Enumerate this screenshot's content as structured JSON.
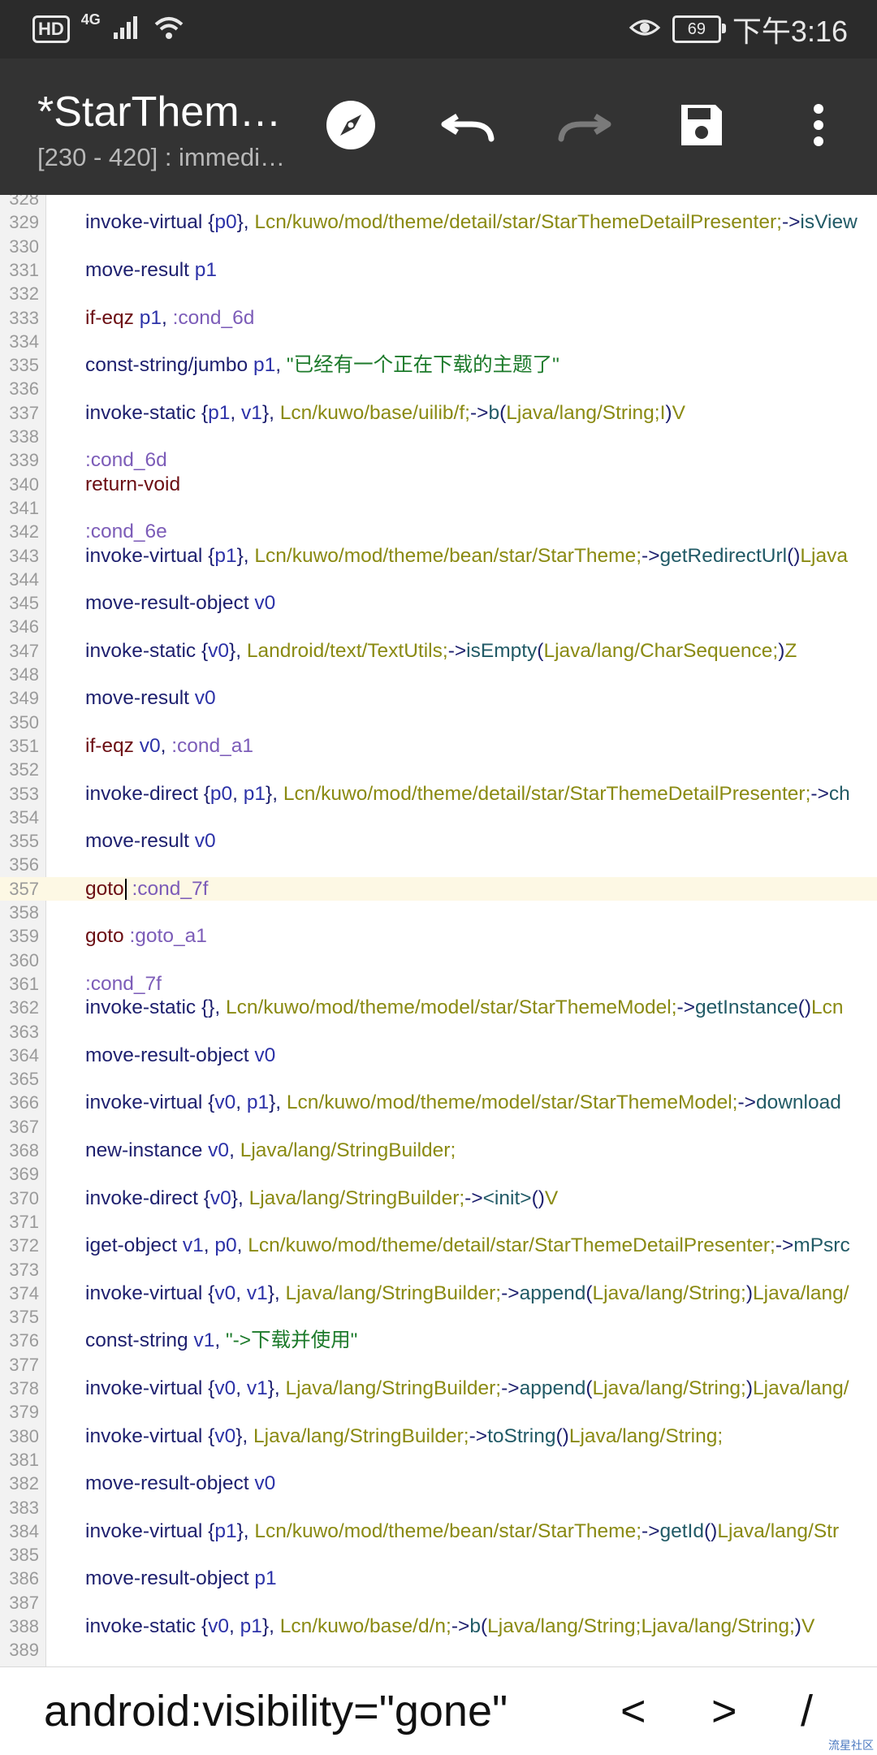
{
  "status_bar": {
    "hd": "HD",
    "network": "4G",
    "battery": "69",
    "time": "下午3:16",
    "icons": [
      "signal-icon",
      "wifi-icon",
      "eye-icon",
      "battery-icon"
    ]
  },
  "app_bar": {
    "title": "*StarThem…",
    "subtitle": "[230 - 420] : immedi…",
    "actions": [
      "compass-icon",
      "undo-icon",
      "redo-icon",
      "save-icon",
      "more-icon"
    ]
  },
  "editor": {
    "cursor_line": "357",
    "lines": [
      {
        "n": "328",
        "t": []
      },
      {
        "n": "329",
        "t": [
          [
            "op",
            "invoke-virtual "
          ],
          [
            "punct",
            "{"
          ],
          [
            "reg",
            "p0"
          ],
          [
            "punct",
            "}, "
          ],
          [
            "type",
            "Lcn/kuwo/mod/theme/detail/star/StarThemeDetailPresenter;"
          ],
          [
            "punct",
            "->"
          ],
          [
            "meth",
            "isView"
          ]
        ]
      },
      {
        "n": "330",
        "t": []
      },
      {
        "n": "331",
        "t": [
          [
            "op",
            "move-result "
          ],
          [
            "reg",
            "p1"
          ]
        ]
      },
      {
        "n": "332",
        "t": []
      },
      {
        "n": "333",
        "t": [
          [
            "ctl",
            "if-eqz "
          ],
          [
            "reg",
            "p1"
          ],
          [
            "punct",
            ", "
          ],
          [
            "label",
            ":cond_6d"
          ]
        ]
      },
      {
        "n": "334",
        "t": []
      },
      {
        "n": "335",
        "t": [
          [
            "op",
            "const-string/jumbo "
          ],
          [
            "reg",
            "p1"
          ],
          [
            "punct",
            ", "
          ],
          [
            "str",
            "\"已经有一个正在下载的主题了\""
          ]
        ]
      },
      {
        "n": "336",
        "t": []
      },
      {
        "n": "337",
        "t": [
          [
            "op",
            "invoke-static "
          ],
          [
            "punct",
            "{"
          ],
          [
            "reg",
            "p1"
          ],
          [
            "punct",
            ", "
          ],
          [
            "reg",
            "v1"
          ],
          [
            "punct",
            "}, "
          ],
          [
            "type",
            "Lcn/kuwo/base/uilib/f;"
          ],
          [
            "punct",
            "->"
          ],
          [
            "meth",
            "b"
          ],
          [
            "punct",
            "("
          ],
          [
            "type",
            "Ljava/lang/String;I"
          ],
          [
            "punct",
            ")"
          ],
          [
            "type",
            "V"
          ]
        ]
      },
      {
        "n": "338",
        "t": []
      },
      {
        "n": "339",
        "t": [
          [
            "label",
            ":cond_6d"
          ]
        ]
      },
      {
        "n": "340",
        "t": [
          [
            "ctl",
            "return-void"
          ]
        ]
      },
      {
        "n": "341",
        "t": []
      },
      {
        "n": "342",
        "t": [
          [
            "label",
            ":cond_6e"
          ]
        ]
      },
      {
        "n": "343",
        "t": [
          [
            "op",
            "invoke-virtual "
          ],
          [
            "punct",
            "{"
          ],
          [
            "reg",
            "p1"
          ],
          [
            "punct",
            "}, "
          ],
          [
            "type",
            "Lcn/kuwo/mod/theme/bean/star/StarTheme;"
          ],
          [
            "punct",
            "->"
          ],
          [
            "meth",
            "getRedirectUrl"
          ],
          [
            "punct",
            "()"
          ],
          [
            "type",
            "Ljava"
          ]
        ]
      },
      {
        "n": "344",
        "t": []
      },
      {
        "n": "345",
        "t": [
          [
            "op",
            "move-result-object "
          ],
          [
            "reg",
            "v0"
          ]
        ]
      },
      {
        "n": "346",
        "t": []
      },
      {
        "n": "347",
        "t": [
          [
            "op",
            "invoke-static "
          ],
          [
            "punct",
            "{"
          ],
          [
            "reg",
            "v0"
          ],
          [
            "punct",
            "}, "
          ],
          [
            "type",
            "Landroid/text/TextUtils;"
          ],
          [
            "punct",
            "->"
          ],
          [
            "meth",
            "isEmpty"
          ],
          [
            "punct",
            "("
          ],
          [
            "type",
            "Ljava/lang/CharSequence;"
          ],
          [
            "punct",
            ")"
          ],
          [
            "type",
            "Z"
          ]
        ]
      },
      {
        "n": "348",
        "t": []
      },
      {
        "n": "349",
        "t": [
          [
            "op",
            "move-result "
          ],
          [
            "reg",
            "v0"
          ]
        ]
      },
      {
        "n": "350",
        "t": []
      },
      {
        "n": "351",
        "t": [
          [
            "ctl",
            "if-eqz "
          ],
          [
            "reg",
            "v0"
          ],
          [
            "punct",
            ", "
          ],
          [
            "label",
            ":cond_a1"
          ]
        ]
      },
      {
        "n": "352",
        "t": []
      },
      {
        "n": "353",
        "t": [
          [
            "op",
            "invoke-direct "
          ],
          [
            "punct",
            "{"
          ],
          [
            "reg",
            "p0"
          ],
          [
            "punct",
            ", "
          ],
          [
            "reg",
            "p1"
          ],
          [
            "punct",
            "}, "
          ],
          [
            "type",
            "Lcn/kuwo/mod/theme/detail/star/StarThemeDetailPresenter;"
          ],
          [
            "punct",
            "->"
          ],
          [
            "meth",
            "ch"
          ]
        ]
      },
      {
        "n": "354",
        "t": []
      },
      {
        "n": "355",
        "t": [
          [
            "op",
            "move-result "
          ],
          [
            "reg",
            "v0"
          ]
        ]
      },
      {
        "n": "356",
        "t": []
      },
      {
        "n": "357",
        "t": [
          [
            "ctl",
            "goto"
          ],
          [
            "cursor",
            ""
          ],
          [
            "punct",
            " "
          ],
          [
            "label",
            ":cond_7f"
          ]
        ]
      },
      {
        "n": "358",
        "t": []
      },
      {
        "n": "359",
        "t": [
          [
            "ctl",
            "goto "
          ],
          [
            "label",
            ":goto_a1"
          ]
        ]
      },
      {
        "n": "360",
        "t": []
      },
      {
        "n": "361",
        "t": [
          [
            "label",
            ":cond_7f"
          ]
        ]
      },
      {
        "n": "362",
        "t": [
          [
            "op",
            "invoke-static "
          ],
          [
            "punct",
            "{}, "
          ],
          [
            "type",
            "Lcn/kuwo/mod/theme/model/star/StarThemeModel;"
          ],
          [
            "punct",
            "->"
          ],
          [
            "meth",
            "getInstance"
          ],
          [
            "punct",
            "()"
          ],
          [
            "type",
            "Lcn"
          ]
        ]
      },
      {
        "n": "363",
        "t": []
      },
      {
        "n": "364",
        "t": [
          [
            "op",
            "move-result-object "
          ],
          [
            "reg",
            "v0"
          ]
        ]
      },
      {
        "n": "365",
        "t": []
      },
      {
        "n": "366",
        "t": [
          [
            "op",
            "invoke-virtual "
          ],
          [
            "punct",
            "{"
          ],
          [
            "reg",
            "v0"
          ],
          [
            "punct",
            ", "
          ],
          [
            "reg",
            "p1"
          ],
          [
            "punct",
            "}, "
          ],
          [
            "type",
            "Lcn/kuwo/mod/theme/model/star/StarThemeModel;"
          ],
          [
            "punct",
            "->"
          ],
          [
            "meth",
            "download"
          ]
        ]
      },
      {
        "n": "367",
        "t": []
      },
      {
        "n": "368",
        "t": [
          [
            "op",
            "new-instance "
          ],
          [
            "reg",
            "v0"
          ],
          [
            "punct",
            ", "
          ],
          [
            "type",
            "Ljava/lang/StringBuilder;"
          ]
        ]
      },
      {
        "n": "369",
        "t": []
      },
      {
        "n": "370",
        "t": [
          [
            "op",
            "invoke-direct "
          ],
          [
            "punct",
            "{"
          ],
          [
            "reg",
            "v0"
          ],
          [
            "punct",
            "}, "
          ],
          [
            "type",
            "Ljava/lang/StringBuilder;"
          ],
          [
            "punct",
            "->"
          ],
          [
            "meth",
            "<init>"
          ],
          [
            "punct",
            "()"
          ],
          [
            "type",
            "V"
          ]
        ]
      },
      {
        "n": "371",
        "t": []
      },
      {
        "n": "372",
        "t": [
          [
            "op",
            "iget-object "
          ],
          [
            "reg",
            "v1"
          ],
          [
            "punct",
            ", "
          ],
          [
            "reg",
            "p0"
          ],
          [
            "punct",
            ", "
          ],
          [
            "type",
            "Lcn/kuwo/mod/theme/detail/star/StarThemeDetailPresenter;"
          ],
          [
            "punct",
            "->"
          ],
          [
            "meth",
            "mPsrc"
          ]
        ]
      },
      {
        "n": "373",
        "t": []
      },
      {
        "n": "374",
        "t": [
          [
            "op",
            "invoke-virtual "
          ],
          [
            "punct",
            "{"
          ],
          [
            "reg",
            "v0"
          ],
          [
            "punct",
            ", "
          ],
          [
            "reg",
            "v1"
          ],
          [
            "punct",
            "}, "
          ],
          [
            "type",
            "Ljava/lang/StringBuilder;"
          ],
          [
            "punct",
            "->"
          ],
          [
            "meth",
            "append"
          ],
          [
            "punct",
            "("
          ],
          [
            "type",
            "Ljava/lang/String;"
          ],
          [
            "punct",
            ")"
          ],
          [
            "type",
            "Ljava/lang/"
          ]
        ]
      },
      {
        "n": "375",
        "t": []
      },
      {
        "n": "376",
        "t": [
          [
            "op",
            "const-string "
          ],
          [
            "reg",
            "v1"
          ],
          [
            "punct",
            ", "
          ],
          [
            "str",
            "\"->下载并使用\""
          ]
        ]
      },
      {
        "n": "377",
        "t": []
      },
      {
        "n": "378",
        "t": [
          [
            "op",
            "invoke-virtual "
          ],
          [
            "punct",
            "{"
          ],
          [
            "reg",
            "v0"
          ],
          [
            "punct",
            ", "
          ],
          [
            "reg",
            "v1"
          ],
          [
            "punct",
            "}, "
          ],
          [
            "type",
            "Ljava/lang/StringBuilder;"
          ],
          [
            "punct",
            "->"
          ],
          [
            "meth",
            "append"
          ],
          [
            "punct",
            "("
          ],
          [
            "type",
            "Ljava/lang/String;"
          ],
          [
            "punct",
            ")"
          ],
          [
            "type",
            "Ljava/lang/"
          ]
        ]
      },
      {
        "n": "379",
        "t": []
      },
      {
        "n": "380",
        "t": [
          [
            "op",
            "invoke-virtual "
          ],
          [
            "punct",
            "{"
          ],
          [
            "reg",
            "v0"
          ],
          [
            "punct",
            "}, "
          ],
          [
            "type",
            "Ljava/lang/StringBuilder;"
          ],
          [
            "punct",
            "->"
          ],
          [
            "meth",
            "toString"
          ],
          [
            "punct",
            "()"
          ],
          [
            "type",
            "Ljava/lang/String;"
          ]
        ]
      },
      {
        "n": "381",
        "t": []
      },
      {
        "n": "382",
        "t": [
          [
            "op",
            "move-result-object "
          ],
          [
            "reg",
            "v0"
          ]
        ]
      },
      {
        "n": "383",
        "t": []
      },
      {
        "n": "384",
        "t": [
          [
            "op",
            "invoke-virtual "
          ],
          [
            "punct",
            "{"
          ],
          [
            "reg",
            "p1"
          ],
          [
            "punct",
            "}, "
          ],
          [
            "type",
            "Lcn/kuwo/mod/theme/bean/star/StarTheme;"
          ],
          [
            "punct",
            "->"
          ],
          [
            "meth",
            "getId"
          ],
          [
            "punct",
            "()"
          ],
          [
            "type",
            "Ljava/lang/Str"
          ]
        ]
      },
      {
        "n": "385",
        "t": []
      },
      {
        "n": "386",
        "t": [
          [
            "op",
            "move-result-object "
          ],
          [
            "reg",
            "p1"
          ]
        ]
      },
      {
        "n": "387",
        "t": []
      },
      {
        "n": "388",
        "t": [
          [
            "op",
            "invoke-static "
          ],
          [
            "punct",
            "{"
          ],
          [
            "reg",
            "v0"
          ],
          [
            "punct",
            ", "
          ],
          [
            "reg",
            "p1"
          ],
          [
            "punct",
            "}, "
          ],
          [
            "type",
            "Lcn/kuwo/base/d/n;"
          ],
          [
            "punct",
            "->"
          ],
          [
            "meth",
            "b"
          ],
          [
            "punct",
            "("
          ],
          [
            "type",
            "Ljava/lang/String;Ljava/lang/String;"
          ],
          [
            "punct",
            ")"
          ],
          [
            "type",
            "V"
          ]
        ]
      },
      {
        "n": "389",
        "t": []
      }
    ]
  },
  "bottom_bar": {
    "snippets": [
      "android:visibility=\"gone\"",
      "<",
      ">",
      "/"
    ],
    "watermark": "流星社区"
  }
}
